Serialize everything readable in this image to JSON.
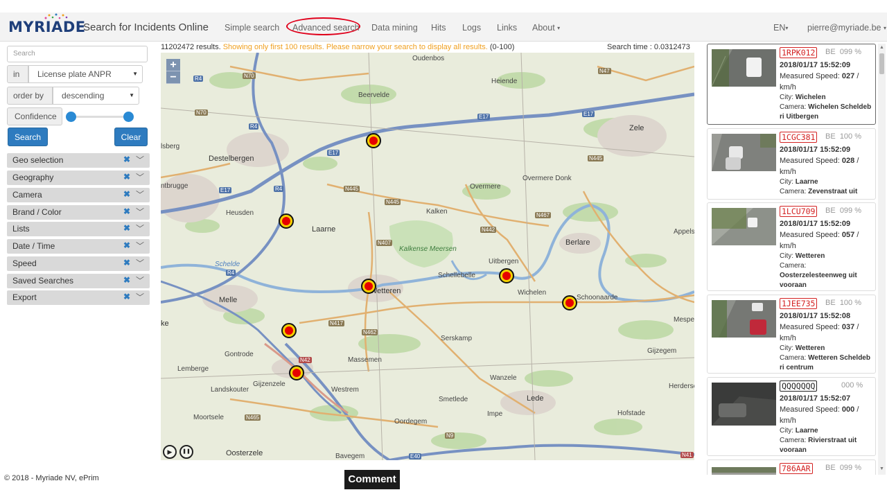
{
  "header": {
    "logo": "MYRIADE",
    "app_title": "Search for Incidents Online",
    "nav": [
      "Simple search",
      "Advanced search",
      "Data mining",
      "Hits",
      "Logs",
      "Links",
      "About"
    ],
    "about_caret": "▾",
    "language": "EN",
    "user": "pierre@myriade.be",
    "highlight_color": "#e0001b"
  },
  "sidebar": {
    "search_placeholder": "Search",
    "in_label": "in",
    "in_value": "License plate ANPR",
    "order_label": "order by",
    "order_value": "descending",
    "confidence_label": "Confidence",
    "confidence_range": [
      0,
      100
    ],
    "search_button": "Search",
    "clear_button": "Clear",
    "filters": [
      "Geo selection",
      "Geography",
      "Camera",
      "Brand / Color",
      "Lists",
      "Date / Time",
      "Speed",
      "Saved Searches",
      "Export"
    ],
    "accent_color": "#2e7bbf"
  },
  "results": {
    "count_text": "11202472 results.",
    "warning_text": "Showing only first 100 results. Please narrow your search to display all results.",
    "range_text": "(0-100)",
    "search_time": "Search time : 0.0312473"
  },
  "map": {
    "zoom_in": "+",
    "zoom_out": "−",
    "labels": {
      "oudenbos": "Oudenbos",
      "beervelde": "Beervelde",
      "heiende": "Heiende",
      "destelbergen": "Destelbergen",
      "zele": "Zele",
      "ntbrugge": "ntbrugge",
      "overmere": "Overmere",
      "overmere_donk": "Overmere Donk",
      "laarne": "Laarne",
      "kalken": "Kalken",
      "heusden": "Heusden",
      "berlare": "Berlare",
      "appels": "Appels",
      "kalkense_meersen": "Kalkense Meersen",
      "uitbergen": "Uitbergen",
      "schellebelle": "Schellebelle",
      "wetteren": "Wetteren",
      "melle": "Melle",
      "wichelen": "Wichelen",
      "schoonaarde": "Schoonaarde",
      "mespel": "Mespel",
      "ke": "ke",
      "serskamp": "Serskamp",
      "gontrode": "Gontrode",
      "massemen": "Massemen",
      "gijzegem": "Gijzegem",
      "lemberge": "Lemberge",
      "gijzenzele": "Gijzenzele",
      "landskouter": "Landskouter",
      "westrem": "Westrem",
      "wanzele": "Wanzele",
      "herderse": "Herderse",
      "smetlede": "Smetlede",
      "lede": "Lede",
      "moortsele": "Moortsele",
      "oordegem": "Oordegem",
      "impe": "Impe",
      "hofstade": "Hofstade",
      "oosterzele": "Oosterzele",
      "bavegem": "Bavegem",
      "isberg": "lsberg",
      "schelde": "Schelde"
    },
    "roads": {
      "n70a": "N70",
      "n70b": "N70",
      "r4a": "R4",
      "r4b": "R4",
      "r4c": "R4",
      "r4d": "R4",
      "e17a": "E17",
      "e17b": "E17",
      "e17c": "E17",
      "e17d": "E17",
      "n445a": "N445",
      "n445b": "N445",
      "n445c": "N445",
      "n47": "N47",
      "n442": "N442",
      "n467": "N467",
      "n407": "N407",
      "n417": "N417",
      "n462": "N462",
      "n42": "N42",
      "n465": "N465",
      "n9": "N9",
      "e40": "E40",
      "n41": "N41"
    },
    "play_icon": "▶",
    "pause_icon": "❚❚"
  },
  "cards": [
    {
      "plate": "1RPK012",
      "country": "BE",
      "confidence": "099 %",
      "datetime": "2018/01/17 15:52:09",
      "speed_label": "Measured Speed:",
      "speed": "027",
      "unit": "/ km/h",
      "city_label": "City:",
      "city": "Wichelen",
      "camera_label": "Camera:",
      "camera": "Wichelen Scheldeb ri Uitbergen"
    },
    {
      "plate": "1CGC381",
      "country": "BE",
      "confidence": "100 %",
      "datetime": "2018/01/17 15:52:09",
      "speed_label": "Measured Speed:",
      "speed": "028",
      "unit": "/ km/h",
      "city_label": "City:",
      "city": "Laarne",
      "camera_label": "Camera:",
      "camera": "Zevenstraat uit"
    },
    {
      "plate": "1LCU709",
      "country": "BE",
      "confidence": "099 %",
      "datetime": "2018/01/17 15:52:09",
      "speed_label": "Measured Speed:",
      "speed": "057",
      "unit": "/ km/h",
      "city_label": "City:",
      "city": "Wetteren",
      "camera_label": "Camera:",
      "camera": "Oosterzelesteenweg uit vooraan"
    },
    {
      "plate": "1JEE735",
      "country": "BE",
      "confidence": "100 %",
      "datetime": "2018/01/17 15:52:08",
      "speed_label": "Measured Speed:",
      "speed": "037",
      "unit": "/ km/h",
      "city_label": "City:",
      "city": "Wetteren",
      "camera_label": "Camera:",
      "camera": "Wetteren Scheldeb ri centrum"
    },
    {
      "plate": "QQQQQQQ",
      "country": "",
      "confidence": "000 %",
      "datetime": "2018/01/17 15:52:07",
      "speed_label": "Measured Speed:",
      "speed": "000",
      "unit": "/ km/h",
      "city_label": "City:",
      "city": "Laarne",
      "camera_label": "Camera:",
      "camera": "Rivierstraat uit vooraan"
    },
    {
      "plate": "786AAR",
      "country": "BE",
      "confidence": "099 %"
    }
  ],
  "footer": {
    "copyright": "© 2018 - Myriade NV, ePrim",
    "comment": "Comment"
  }
}
